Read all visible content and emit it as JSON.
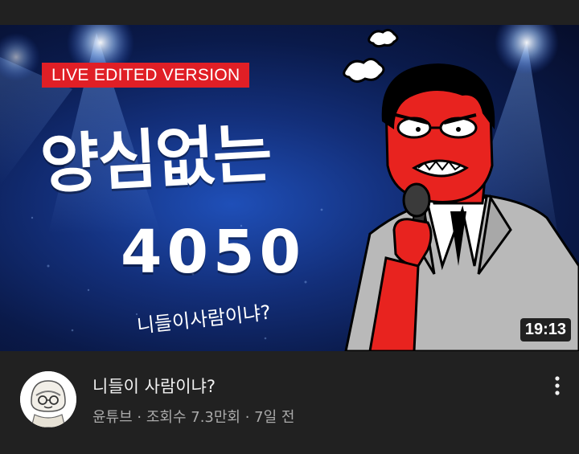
{
  "thumbnail": {
    "badge": "LIVE EDITED VERSION",
    "title_line1": "양심없는",
    "title_line2": "4050",
    "subtitle": "니들이사람이냐?",
    "duration": "19:13"
  },
  "video": {
    "title": "니들이 사람이냐?",
    "subtitle": "윤튜브 · 조회수 7.3만회 · 7일 전"
  },
  "icons": {
    "more": "more-vertical-icon",
    "avatar": "channel-avatar"
  },
  "colors": {
    "background": "#212121",
    "badge": "#e01f26",
    "thumbnail_blue": "#1f4fb8",
    "face_red": "#e8231f"
  }
}
